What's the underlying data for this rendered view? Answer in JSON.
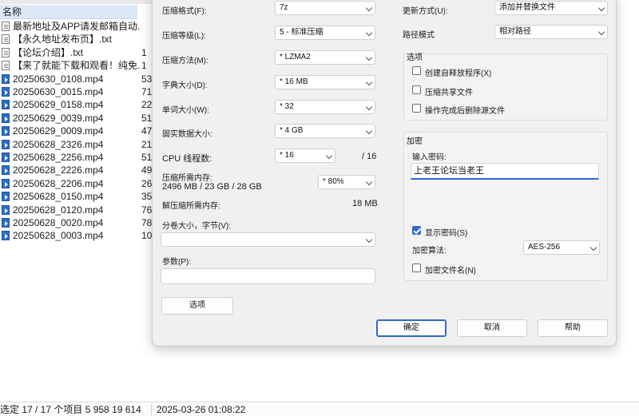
{
  "explorer": {
    "column_header": "名称",
    "files": [
      {
        "name": "最新地址及APP请发邮箱自动...",
        "size": "",
        "type": "txt"
      },
      {
        "name": "【永久地址发布页】.txt",
        "size": "",
        "type": "txt"
      },
      {
        "name": "【论坛介绍】.txt",
        "size": "1",
        "type": "txt"
      },
      {
        "name": "【来了就能下载和观看！纯免...",
        "size": "1",
        "type": "txt"
      },
      {
        "name": "20250630_0108.mp4",
        "size": "53",
        "type": "mp4"
      },
      {
        "name": "20250630_0015.mp4",
        "size": "71",
        "type": "mp4"
      },
      {
        "name": "20250629_0158.mp4",
        "size": "22",
        "type": "mp4"
      },
      {
        "name": "20250629_0039.mp4",
        "size": "51",
        "type": "mp4"
      },
      {
        "name": "20250629_0009.mp4",
        "size": "47",
        "type": "mp4"
      },
      {
        "name": "20250628_2326.mp4",
        "size": "21",
        "type": "mp4"
      },
      {
        "name": "20250628_2256.mp4",
        "size": "51",
        "type": "mp4"
      },
      {
        "name": "20250628_2226.mp4",
        "size": "49",
        "type": "mp4"
      },
      {
        "name": "20250628_2206.mp4",
        "size": "26",
        "type": "mp4"
      },
      {
        "name": "20250628_0150.mp4",
        "size": "35",
        "type": "mp4"
      },
      {
        "name": "20250628_0120.mp4",
        "size": "76",
        "type": "mp4"
      },
      {
        "name": "20250628_0020.mp4",
        "size": "78",
        "type": "mp4"
      },
      {
        "name": "20250628_0003.mp4",
        "size": "10",
        "type": "mp4"
      }
    ],
    "status": {
      "selection": "选定 17 / 17 个项目 5 958 19 614",
      "date": "2025-03-26 01:08:22"
    }
  },
  "dialog": {
    "format": {
      "label": "压缩格式(F):",
      "value": "7z"
    },
    "level": {
      "label": "压缩等级(L):",
      "value": "5 - 标准压缩"
    },
    "method": {
      "label": "压缩方法(M):",
      "value": "*  LZMA2"
    },
    "dict": {
      "label": "字典大小(D):",
      "value": "*  16 MB"
    },
    "word": {
      "label": "单词大小(W):",
      "value": "*  32"
    },
    "solid": {
      "label": "固实数据大小:",
      "value": "*  4 GB"
    },
    "cpu": {
      "label": "CPU 线程数:",
      "value": "*  16",
      "total": "/ 16"
    },
    "mem_compress": {
      "label": "压缩所需内存:",
      "value": "2496 MB / 23 GB / 28 GB",
      "percent": "* 80%"
    },
    "mem_decompress": {
      "label": "解压缩所需内存:",
      "value": "18 MB"
    },
    "volume": {
      "label": "分卷大小，字节(V):",
      "value": ""
    },
    "params": {
      "label": "参数(P):",
      "value": ""
    },
    "options_button": "选项",
    "update_mode": {
      "label": "更新方式(U):",
      "value": "添加并替换文件"
    },
    "path_mode": {
      "label": "路径模式",
      "value": "相对路径"
    },
    "options_group": {
      "title": "选项",
      "sfx": {
        "label": "创建自释放程序(X)",
        "checked": false
      },
      "shared": {
        "label": "压缩共享文件",
        "checked": false
      },
      "delete": {
        "label": "操作完成后删除源文件",
        "checked": false
      }
    },
    "encryption": {
      "title": "加密",
      "password_label": "输入密码:",
      "password_value": "上老王论坛当老王",
      "show_password": {
        "label": "显示密码(S)",
        "checked": true
      },
      "method_label": "加密算法:",
      "method_value": "AES-256",
      "encrypt_names": {
        "label": "加密文件名(N)",
        "checked": false
      }
    },
    "buttons": {
      "ok": "确定",
      "cancel": "取消",
      "help": "帮助"
    }
  }
}
